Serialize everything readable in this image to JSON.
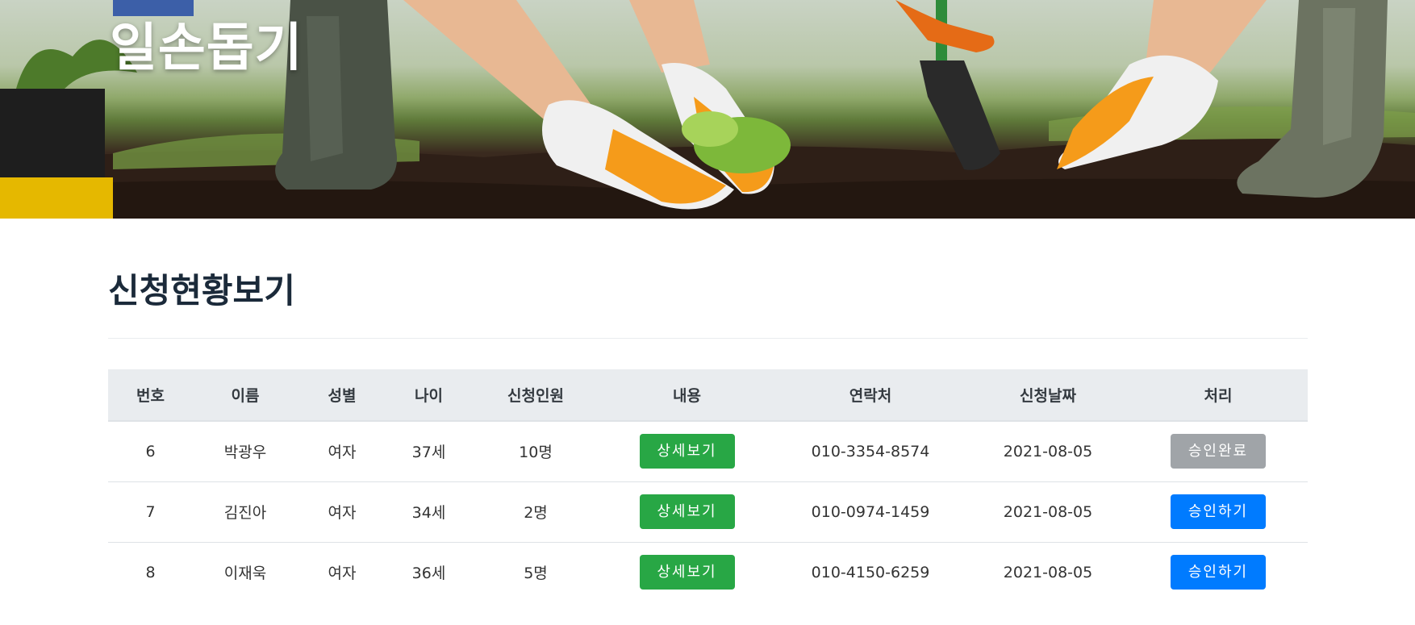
{
  "hero": {
    "title": "일손돕기"
  },
  "page": {
    "title": "신청현황보기"
  },
  "table": {
    "headers": [
      "번호",
      "이름",
      "성별",
      "나이",
      "신청인원",
      "내용",
      "연락처",
      "신청날짜",
      "처리"
    ],
    "rows": [
      {
        "no": "6",
        "name": "박광우",
        "gender": "여자",
        "age": "37세",
        "people": "10명",
        "detail_label": "상세보기",
        "phone": "010-3354-8574",
        "date": "2021-08-05",
        "action_label": "승인완료",
        "action_state": "done"
      },
      {
        "no": "7",
        "name": "김진아",
        "gender": "여자",
        "age": "34세",
        "people": "2명",
        "detail_label": "상세보기",
        "phone": "010-0974-1459",
        "date": "2021-08-05",
        "action_label": "승인하기",
        "action_state": "pending"
      },
      {
        "no": "8",
        "name": "이재욱",
        "gender": "여자",
        "age": "36세",
        "people": "5명",
        "detail_label": "상세보기",
        "phone": "010-4150-6259",
        "date": "2021-08-05",
        "action_label": "승인하기",
        "action_state": "pending"
      }
    ]
  },
  "colors": {
    "detail_button": "#28a745",
    "approve_button": "#007bff",
    "done_button": "#a0a4a8",
    "header_bg": "#e9ecef"
  }
}
